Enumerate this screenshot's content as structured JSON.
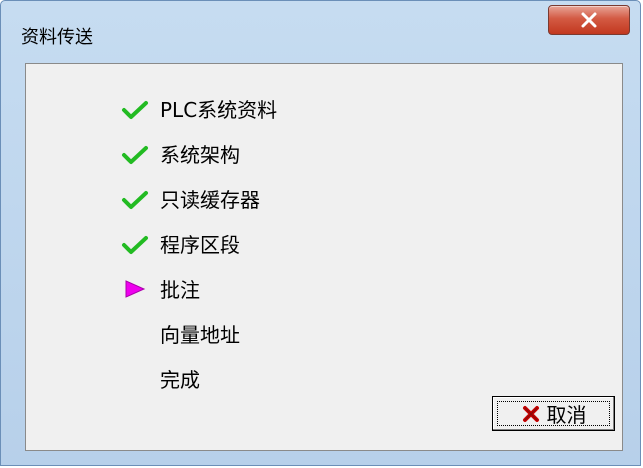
{
  "window": {
    "title": "资料传送",
    "close_icon": "close-icon"
  },
  "steps": [
    {
      "label": "PLC系统资料",
      "status": "done",
      "icon": "check-icon"
    },
    {
      "label": "系统架构",
      "status": "done",
      "icon": "check-icon"
    },
    {
      "label": "只读缓存器",
      "status": "done",
      "icon": "check-icon"
    },
    {
      "label": "程序区段",
      "status": "done",
      "icon": "check-icon"
    },
    {
      "label": "批注",
      "status": "current",
      "icon": "arrow-right-icon"
    },
    {
      "label": "向量地址",
      "status": "pending",
      "icon": ""
    },
    {
      "label": "完成",
      "status": "pending",
      "icon": ""
    }
  ],
  "cancel_button": {
    "label": "取消",
    "icon": "x-icon"
  },
  "colors": {
    "check": "#22bb22",
    "current_arrow": "#ee00ee",
    "close_button": "#c8452d",
    "cancel_x": "#cc0000"
  }
}
